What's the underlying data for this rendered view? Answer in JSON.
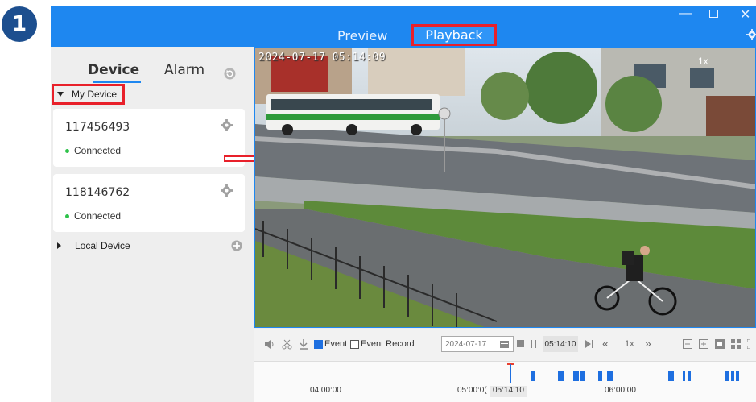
{
  "step_number": "1",
  "window": {
    "tabs": {
      "preview": "Preview",
      "playback": "Playback"
    },
    "controls": {
      "minimize": "—",
      "close": "✕"
    }
  },
  "sidebar": {
    "tabs": {
      "device": "Device",
      "alarm": "Alarm"
    },
    "my_device_label": "My Device",
    "devices": [
      {
        "id": "117456493",
        "status": "Connected"
      },
      {
        "id": "118146762",
        "status": "Connected"
      }
    ],
    "local_device_label": "Local Device"
  },
  "video": {
    "timestamp": "2024-07-17 05:14:09",
    "speed": "1x"
  },
  "controls": {
    "event_label": "Event",
    "event_record_label": "Event Record",
    "date": "2024-07-17",
    "time": "05:14:10",
    "speed": "1x",
    "event_checked": true,
    "event_record_checked": false
  },
  "timeline": {
    "labels": [
      "04:00:00",
      "05:00:0(",
      "06:00:00"
    ],
    "current_time": "05:14:10"
  },
  "colors": {
    "accent": "#1e87f0",
    "highlight_box": "#e8202a",
    "status_ok": "#2ec24a",
    "event_blue": "#1e6fe0"
  }
}
